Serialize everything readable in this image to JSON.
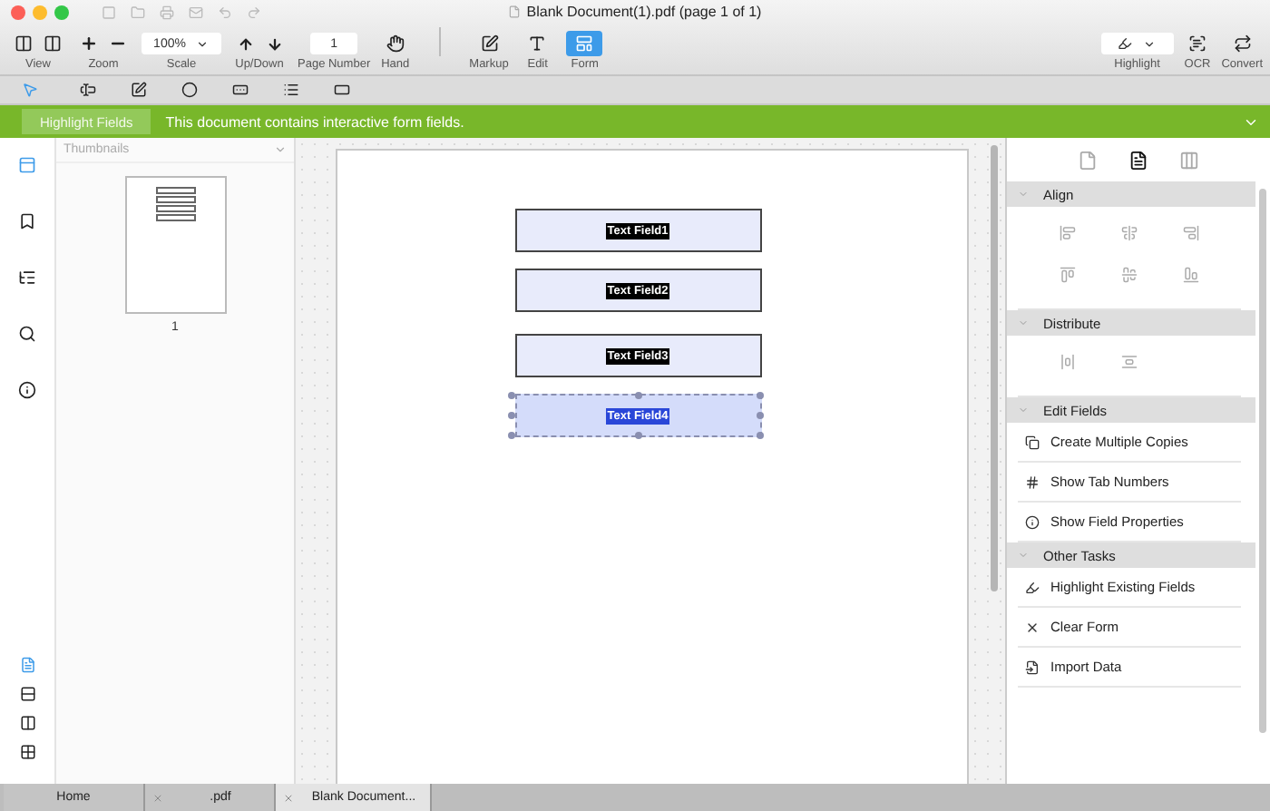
{
  "window": {
    "title": "Blank Document(1).pdf (page 1 of 1)"
  },
  "toolbar": {
    "groups": [
      {
        "kind": "view",
        "label": "View"
      },
      {
        "kind": "zoom",
        "label": "Zoom"
      },
      {
        "kind": "scale",
        "label": "Scale",
        "value": "100%"
      },
      {
        "kind": "updown",
        "label": "Up/Down"
      },
      {
        "kind": "page",
        "label": "Page Number",
        "value": "1"
      },
      {
        "kind": "hand",
        "label": "Hand"
      },
      {
        "kind": "sep"
      },
      {
        "kind": "markup",
        "label": "Markup",
        "selected": false
      },
      {
        "kind": "edit",
        "label": "Edit",
        "selected": false
      },
      {
        "kind": "form",
        "label": "Form",
        "selected": true
      }
    ],
    "right": [
      {
        "kind": "highlight",
        "label": "Highlight"
      },
      {
        "kind": "ocr",
        "label": "OCR"
      },
      {
        "kind": "convert",
        "label": "Convert"
      }
    ]
  },
  "form_tools": [
    {
      "kind": "select",
      "selected": true
    },
    {
      "kind": "text",
      "selected": false
    },
    {
      "kind": "check",
      "selected": false
    },
    {
      "kind": "radio",
      "selected": false
    },
    {
      "kind": "combo",
      "selected": false
    },
    {
      "kind": "list",
      "selected": false
    },
    {
      "kind": "button",
      "selected": false
    }
  ],
  "banner": {
    "button": "Highlight Fields",
    "message": "This document contains interactive form fields."
  },
  "sidebar": {
    "items": [
      {
        "kind": "thumbs",
        "selected": true
      },
      {
        "kind": "bookmark",
        "selected": false
      },
      {
        "kind": "outline",
        "selected": false
      },
      {
        "kind": "search",
        "selected": false
      },
      {
        "kind": "info",
        "selected": false
      }
    ],
    "views": [
      {
        "kind": "single",
        "selected": true
      },
      {
        "kind": "scroll",
        "selected": false
      },
      {
        "kind": "double",
        "selected": false
      },
      {
        "kind": "grid",
        "selected": false
      }
    ]
  },
  "thumbnails": {
    "title": "Thumbnails",
    "pages": [
      {
        "label": "1",
        "selected": false
      }
    ]
  },
  "document": {
    "fields": [
      {
        "label": "Text Field1",
        "selected": false
      },
      {
        "label": "Text Field2",
        "selected": false
      },
      {
        "label": "Text Field3",
        "selected": false
      },
      {
        "label": "Text Field4",
        "selected": true
      }
    ]
  },
  "panel": {
    "tabs": [
      {
        "kind": "page",
        "selected": false
      },
      {
        "kind": "doc",
        "selected": true
      },
      {
        "kind": "props",
        "selected": false
      }
    ],
    "sections": [
      {
        "title": "Align",
        "expanded": true,
        "kind": "align"
      },
      {
        "title": "Distribute",
        "expanded": true,
        "kind": "distribute"
      },
      {
        "title": "Edit Fields",
        "expanded": true,
        "kind": "list",
        "items": [
          "Create Multiple Copies",
          "Show Tab Numbers",
          "Show Field Properties"
        ]
      },
      {
        "title": "Other Tasks",
        "expanded": true,
        "kind": "list",
        "items": [
          "Highlight Existing Fields",
          "Clear Form",
          "Import Data"
        ]
      }
    ]
  },
  "tabs": [
    {
      "label": "Home",
      "closable": false,
      "selected": false
    },
    {
      "label": ".pdf",
      "closable": true,
      "selected": false
    },
    {
      "label": "Blank Document...",
      "closable": true,
      "selected": true
    }
  ]
}
